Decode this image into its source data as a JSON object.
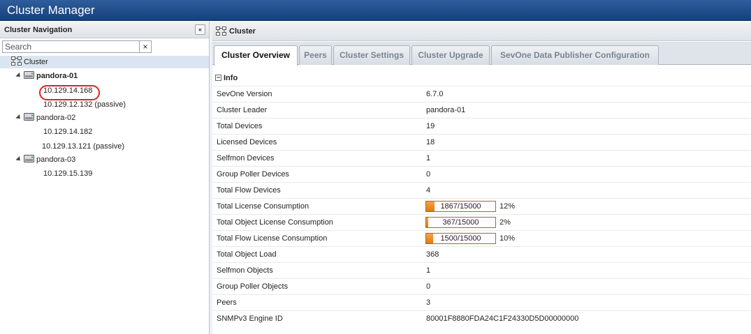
{
  "window": {
    "title": "Cluster Manager"
  },
  "nav": {
    "header": "Cluster Navigation",
    "search_placeholder": "Search",
    "clear_label": "×",
    "collapse_label": "«",
    "root": "Cluster",
    "nodes": [
      {
        "name": "pandora-01",
        "ips": [
          "10.129.14.168",
          "10.129.12.132 (passive)"
        ]
      },
      {
        "name": "pandora-02",
        "ips": [
          "10.129.14.182",
          "10.129.13.121 (passive)"
        ]
      },
      {
        "name": "pandora-03",
        "ips": [
          "10.129.15.139"
        ]
      }
    ]
  },
  "main": {
    "header": "Cluster",
    "tabs": [
      {
        "label": "Cluster Overview"
      },
      {
        "label": "Peers"
      },
      {
        "label": "Cluster Settings"
      },
      {
        "label": "Cluster Upgrade"
      },
      {
        "label": "SevOne Data Publisher Configuration"
      }
    ],
    "section": "Info",
    "rows": [
      {
        "key": "SevOne Version",
        "value": "6.7.0"
      },
      {
        "key": "Cluster Leader",
        "value": "pandora-01"
      },
      {
        "key": "Total Devices",
        "value": "19"
      },
      {
        "key": "Licensed Devices",
        "value": "18"
      },
      {
        "key": "Selfmon Devices",
        "value": "1"
      },
      {
        "key": "Group Poller Devices",
        "value": "0"
      },
      {
        "key": "Total Flow Devices",
        "value": "4"
      },
      {
        "key": "Total License Consumption",
        "bar": "1867/15000",
        "percent": "12%",
        "fraction": 0.12
      },
      {
        "key": "Total Object License Consumption",
        "bar": "367/15000",
        "percent": "2%",
        "fraction": 0.02
      },
      {
        "key": "Total Flow License Consumption",
        "bar": "1500/15000",
        "percent": "10%",
        "fraction": 0.1
      },
      {
        "key": "Total Object Load",
        "value": "368"
      },
      {
        "key": "Selfmon Objects",
        "value": "1"
      },
      {
        "key": "Group Poller Objects",
        "value": "0"
      },
      {
        "key": "Peers",
        "value": "3"
      },
      {
        "key": "SNMPv3 Engine ID",
        "value": "80001F8880FDA24C1F24330D5D00000000"
      }
    ]
  },
  "colors": {
    "title_bar": "#1f4e8c",
    "selection": "#dbe5f1",
    "progress": "#f08c2a",
    "highlight_circle": "#d9261c"
  }
}
